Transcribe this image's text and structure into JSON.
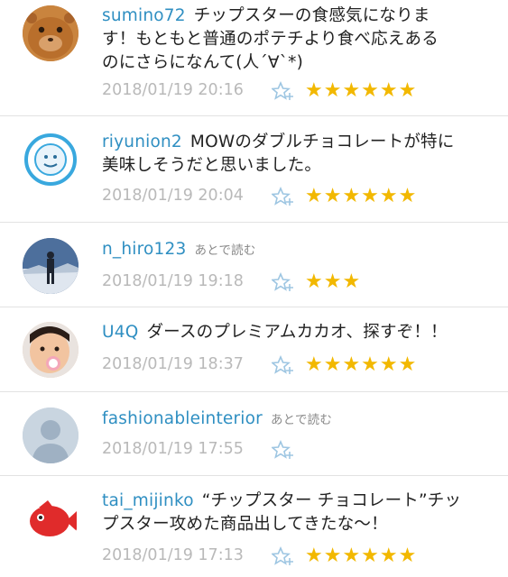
{
  "comments": [
    {
      "user": "sumino72",
      "text_lines": [
        "チップスターの食感気になりま",
        "す！もともと普通のポテチより食べ応えある",
        "のにさらになんて(人´∀`*)"
      ],
      "later": "",
      "date": "2018/01/19 20:16",
      "stars": "★★★★★★",
      "avatar": "hamster-avatar"
    },
    {
      "user": "riyunion2",
      "text_lines": [
        "MOWのダブルチョコレートが特に",
        "美味しそうだと思いました。"
      ],
      "later": "",
      "date": "2018/01/19 20:04",
      "stars": "★★★★★★",
      "avatar": "badge-avatar"
    },
    {
      "user": "n_hiro123",
      "text_lines": [
        ""
      ],
      "later": "あとで読む",
      "date": "2018/01/19 19:18",
      "stars": "★★★",
      "avatar": "climber-avatar"
    },
    {
      "user": "U4Q",
      "text_lines": [
        "ダースのプレミアムカカオ、探すぞ！！"
      ],
      "later": "",
      "date": "2018/01/19 18:37",
      "stars": "★★★★★★",
      "avatar": "baby-avatar"
    },
    {
      "user": "fashionableinterior",
      "text_lines": [
        ""
      ],
      "later": "あとで読む",
      "date": "2018/01/19 17:55",
      "stars": "",
      "avatar": "default-user-avatar"
    },
    {
      "user": "tai_mijinko",
      "text_lines": [
        "“チップスター チョコレート”チッ",
        "プスター攻めた商品出してきたな～！"
      ],
      "later": "",
      "date": "2018/01/19 17:13",
      "stars": "★★★★★★",
      "avatar": "red-fish-avatar"
    }
  ],
  "colors": {
    "username": "#2f8fc2",
    "date": "#b9b9b9",
    "star": "#f2b800",
    "add_star_icon": "#9ec6e2"
  }
}
